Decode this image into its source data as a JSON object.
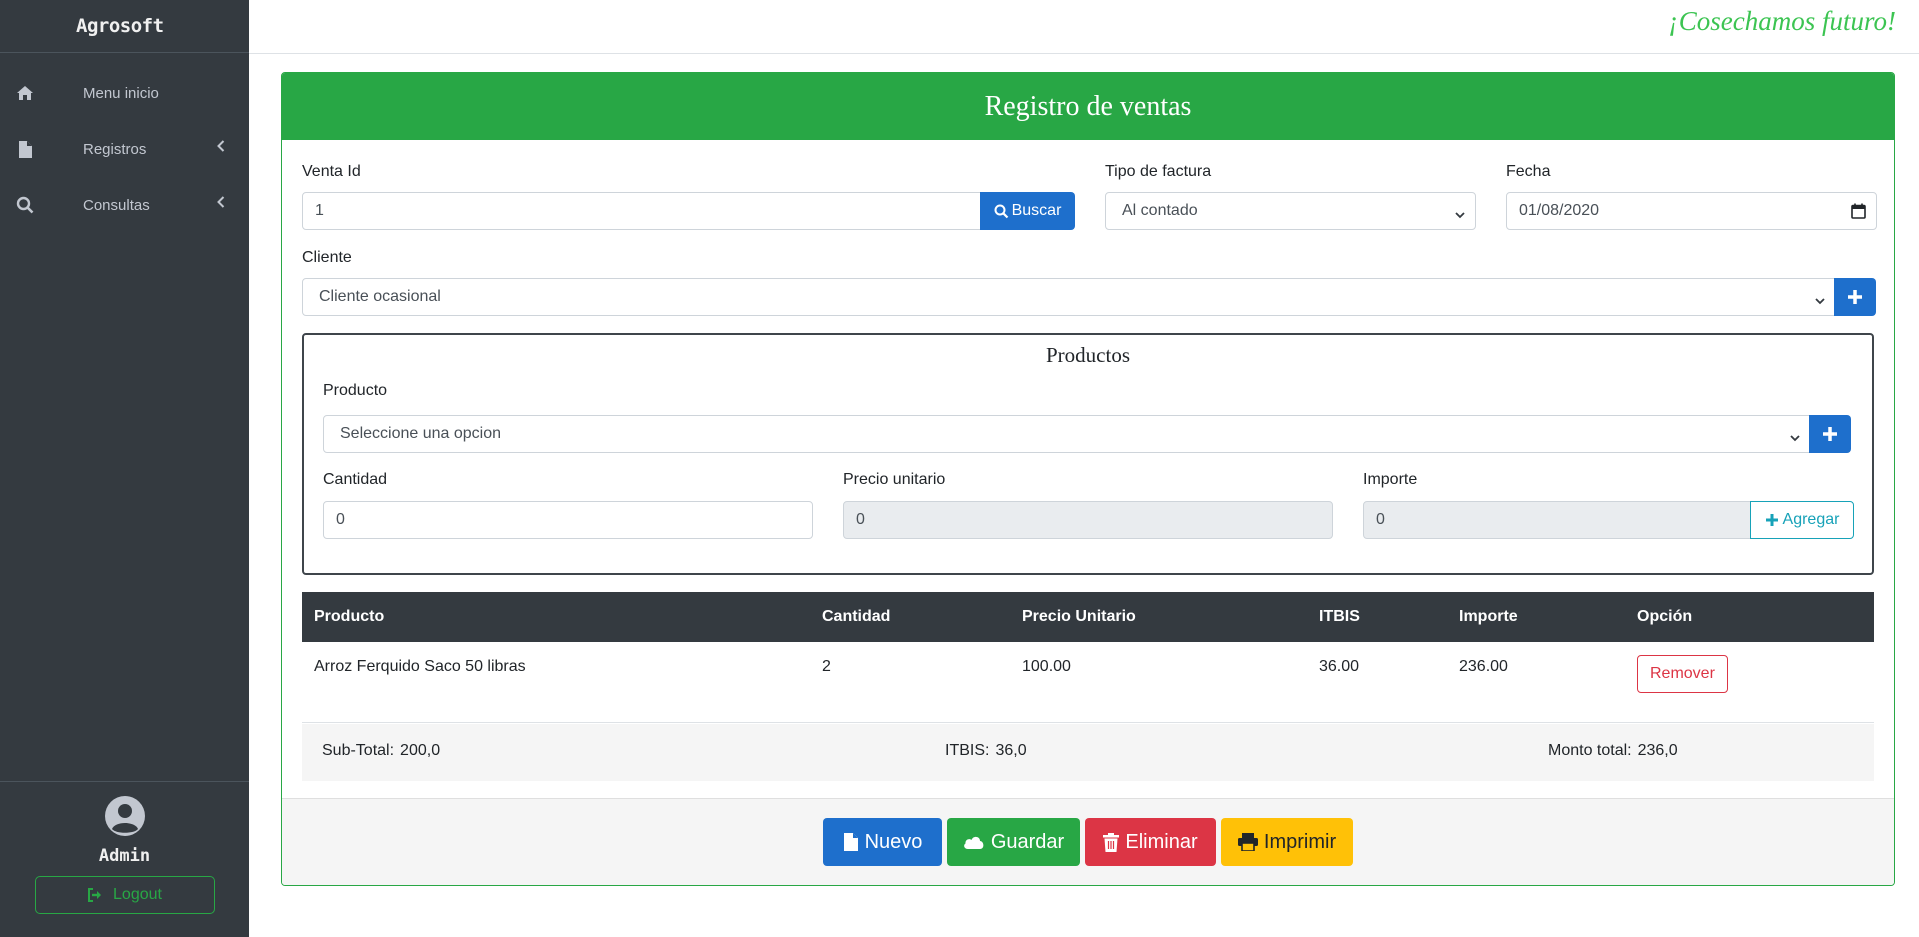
{
  "sidebar": {
    "brand": "Agrosoft",
    "items": [
      {
        "label": "Menu inicio",
        "icon": "home-icon"
      },
      {
        "label": "Registros",
        "icon": "file-icon"
      },
      {
        "label": "Consultas",
        "icon": "search-icon"
      }
    ],
    "user": "Admin",
    "logout_label": "Logout"
  },
  "topbar": {
    "slogan": "¡Cosechamos futuro!"
  },
  "form": {
    "title": "Registro de ventas",
    "venta_id": {
      "label": "Venta Id",
      "value": "1"
    },
    "buscar_label": "Buscar",
    "tipo_factura": {
      "label": "Tipo de factura",
      "value": "Al contado"
    },
    "fecha": {
      "label": "Fecha",
      "value": "01/08/2020"
    },
    "cliente": {
      "label": "Cliente",
      "value": "Cliente ocasional"
    }
  },
  "productos": {
    "title": "Productos",
    "producto": {
      "label": "Producto",
      "value": "Seleccione una opcion"
    },
    "cantidad": {
      "label": "Cantidad",
      "value": "0"
    },
    "precio_unitario": {
      "label": "Precio unitario",
      "value": "0"
    },
    "importe": {
      "label": "Importe",
      "value": "0"
    },
    "agregar_label": "Agregar"
  },
  "table": {
    "headers": [
      "Producto",
      "Cantidad",
      "Precio Unitario",
      "ITBIS",
      "Importe",
      "Opción"
    ],
    "rows": [
      {
        "producto": "Arroz Ferquido Saco 50 libras",
        "cantidad": "2",
        "precio": "100.00",
        "itbis": "36.00",
        "importe": "236.00",
        "action": "Remover"
      }
    ]
  },
  "totals": {
    "subtotal_label": "Sub-Total:",
    "subtotal_value": "200,0",
    "itbis_label": "ITBIS:",
    "itbis_value": "36,0",
    "monto_label": "Monto total:",
    "monto_value": "236,0"
  },
  "actions": {
    "nuevo": "Nuevo",
    "guardar": "Guardar",
    "eliminar": "Eliminar",
    "imprimir": "Imprimir"
  },
  "colors": {
    "sidebar_bg": "#343a40",
    "success": "#28a745",
    "primary": "#1e6fcc",
    "danger": "#dc3545",
    "warning": "#ffc107",
    "info": "#17a2b8"
  }
}
